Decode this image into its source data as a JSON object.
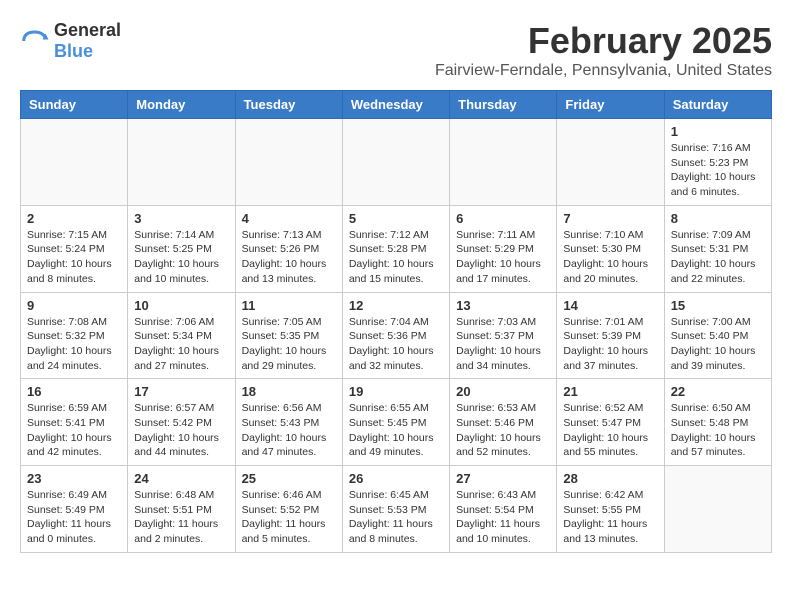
{
  "header": {
    "logo_general": "General",
    "logo_blue": "Blue",
    "month_title": "February 2025",
    "location": "Fairview-Ferndale, Pennsylvania, United States"
  },
  "weekdays": [
    "Sunday",
    "Monday",
    "Tuesday",
    "Wednesday",
    "Thursday",
    "Friday",
    "Saturday"
  ],
  "weeks": [
    [
      {
        "day": "",
        "info": ""
      },
      {
        "day": "",
        "info": ""
      },
      {
        "day": "",
        "info": ""
      },
      {
        "day": "",
        "info": ""
      },
      {
        "day": "",
        "info": ""
      },
      {
        "day": "",
        "info": ""
      },
      {
        "day": "1",
        "info": "Sunrise: 7:16 AM\nSunset: 5:23 PM\nDaylight: 10 hours and 6 minutes."
      }
    ],
    [
      {
        "day": "2",
        "info": "Sunrise: 7:15 AM\nSunset: 5:24 PM\nDaylight: 10 hours and 8 minutes."
      },
      {
        "day": "3",
        "info": "Sunrise: 7:14 AM\nSunset: 5:25 PM\nDaylight: 10 hours and 10 minutes."
      },
      {
        "day": "4",
        "info": "Sunrise: 7:13 AM\nSunset: 5:26 PM\nDaylight: 10 hours and 13 minutes."
      },
      {
        "day": "5",
        "info": "Sunrise: 7:12 AM\nSunset: 5:28 PM\nDaylight: 10 hours and 15 minutes."
      },
      {
        "day": "6",
        "info": "Sunrise: 7:11 AM\nSunset: 5:29 PM\nDaylight: 10 hours and 17 minutes."
      },
      {
        "day": "7",
        "info": "Sunrise: 7:10 AM\nSunset: 5:30 PM\nDaylight: 10 hours and 20 minutes."
      },
      {
        "day": "8",
        "info": "Sunrise: 7:09 AM\nSunset: 5:31 PM\nDaylight: 10 hours and 22 minutes."
      }
    ],
    [
      {
        "day": "9",
        "info": "Sunrise: 7:08 AM\nSunset: 5:32 PM\nDaylight: 10 hours and 24 minutes."
      },
      {
        "day": "10",
        "info": "Sunrise: 7:06 AM\nSunset: 5:34 PM\nDaylight: 10 hours and 27 minutes."
      },
      {
        "day": "11",
        "info": "Sunrise: 7:05 AM\nSunset: 5:35 PM\nDaylight: 10 hours and 29 minutes."
      },
      {
        "day": "12",
        "info": "Sunrise: 7:04 AM\nSunset: 5:36 PM\nDaylight: 10 hours and 32 minutes."
      },
      {
        "day": "13",
        "info": "Sunrise: 7:03 AM\nSunset: 5:37 PM\nDaylight: 10 hours and 34 minutes."
      },
      {
        "day": "14",
        "info": "Sunrise: 7:01 AM\nSunset: 5:39 PM\nDaylight: 10 hours and 37 minutes."
      },
      {
        "day": "15",
        "info": "Sunrise: 7:00 AM\nSunset: 5:40 PM\nDaylight: 10 hours and 39 minutes."
      }
    ],
    [
      {
        "day": "16",
        "info": "Sunrise: 6:59 AM\nSunset: 5:41 PM\nDaylight: 10 hours and 42 minutes."
      },
      {
        "day": "17",
        "info": "Sunrise: 6:57 AM\nSunset: 5:42 PM\nDaylight: 10 hours and 44 minutes."
      },
      {
        "day": "18",
        "info": "Sunrise: 6:56 AM\nSunset: 5:43 PM\nDaylight: 10 hours and 47 minutes."
      },
      {
        "day": "19",
        "info": "Sunrise: 6:55 AM\nSunset: 5:45 PM\nDaylight: 10 hours and 49 minutes."
      },
      {
        "day": "20",
        "info": "Sunrise: 6:53 AM\nSunset: 5:46 PM\nDaylight: 10 hours and 52 minutes."
      },
      {
        "day": "21",
        "info": "Sunrise: 6:52 AM\nSunset: 5:47 PM\nDaylight: 10 hours and 55 minutes."
      },
      {
        "day": "22",
        "info": "Sunrise: 6:50 AM\nSunset: 5:48 PM\nDaylight: 10 hours and 57 minutes."
      }
    ],
    [
      {
        "day": "23",
        "info": "Sunrise: 6:49 AM\nSunset: 5:49 PM\nDaylight: 11 hours and 0 minutes."
      },
      {
        "day": "24",
        "info": "Sunrise: 6:48 AM\nSunset: 5:51 PM\nDaylight: 11 hours and 2 minutes."
      },
      {
        "day": "25",
        "info": "Sunrise: 6:46 AM\nSunset: 5:52 PM\nDaylight: 11 hours and 5 minutes."
      },
      {
        "day": "26",
        "info": "Sunrise: 6:45 AM\nSunset: 5:53 PM\nDaylight: 11 hours and 8 minutes."
      },
      {
        "day": "27",
        "info": "Sunrise: 6:43 AM\nSunset: 5:54 PM\nDaylight: 11 hours and 10 minutes."
      },
      {
        "day": "28",
        "info": "Sunrise: 6:42 AM\nSunset: 5:55 PM\nDaylight: 11 hours and 13 minutes."
      },
      {
        "day": "",
        "info": ""
      }
    ]
  ]
}
